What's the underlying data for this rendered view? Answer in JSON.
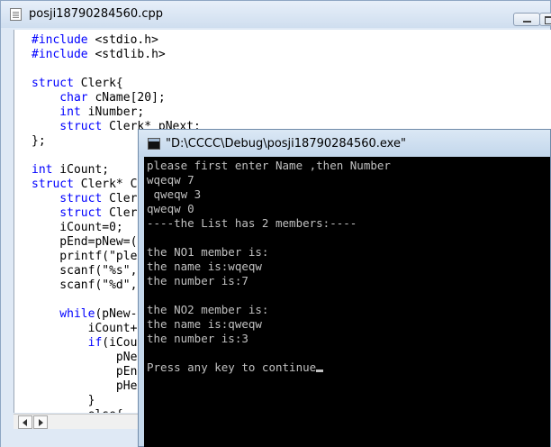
{
  "editor": {
    "title": "posji18790284560.cpp",
    "icons": {
      "file": "cpp-file-icon",
      "minimize": "minimize-icon",
      "maximize": "maximize-icon"
    },
    "code_lines": [
      {
        "kw": "#include",
        "rest": " <stdio.h>"
      },
      {
        "kw": "#include",
        "rest": " <stdlib.h>"
      },
      {
        "kw": "",
        "rest": ""
      },
      {
        "kw": "struct",
        "rest": " Clerk{"
      },
      {
        "kw": "    char",
        "rest": " cName[20];"
      },
      {
        "kw": "    int",
        "rest": " iNumber;"
      },
      {
        "kw": "    struct",
        "rest": " Clerk* pNext;"
      },
      {
        "kw": "",
        "rest": "};"
      },
      {
        "kw": "",
        "rest": ""
      },
      {
        "kw": "int",
        "rest": " iCount;"
      },
      {
        "kw": "struct",
        "rest": " Clerk* C"
      },
      {
        "kw": "    struct",
        "rest": " Cler"
      },
      {
        "kw": "    struct",
        "rest": " Cler"
      },
      {
        "kw": "",
        "rest": "    iCount=0;"
      },
      {
        "kw": "",
        "rest": "    pEnd=pNew=("
      },
      {
        "kw": "",
        "rest": "    printf(\"ple"
      },
      {
        "kw": "",
        "rest": "    scanf(\"%s\","
      },
      {
        "kw": "",
        "rest": "    scanf(\"%d\","
      },
      {
        "kw": "",
        "rest": ""
      },
      {
        "kw": "    while",
        "rest": "(pNew-"
      },
      {
        "kw": "",
        "rest": "        iCount+"
      },
      {
        "kw": "        if",
        "rest": "(iCou"
      },
      {
        "kw": "",
        "rest": "            pNe"
      },
      {
        "kw": "",
        "rest": "            pEn"
      },
      {
        "kw": "",
        "rest": "            pHe"
      },
      {
        "kw": "",
        "rest": "        }"
      },
      {
        "kw": "",
        "rest": "        else{"
      }
    ]
  },
  "console": {
    "title": "\"D:\\CCCC\\Debug\\posji18790284560.exe\"",
    "icon": "console-window-icon",
    "output_lines": [
      "please first enter Name ,then Number",
      "wqeqw 7",
      " qweqw 3",
      "qweqw 0",
      "----the List has 2 members:----",
      "",
      "the NO1 member is:",
      "the name is:wqeqw",
      "the number is:7",
      "",
      "the NO2 member is:",
      "the name is:qweqw",
      "the number is:3",
      "",
      "Press any key to continue"
    ]
  },
  "colors": {
    "keyword": "#0000ff",
    "console_bg": "#000000",
    "console_text": "#c0c0c0",
    "titlebar": "#dbe8f5"
  }
}
